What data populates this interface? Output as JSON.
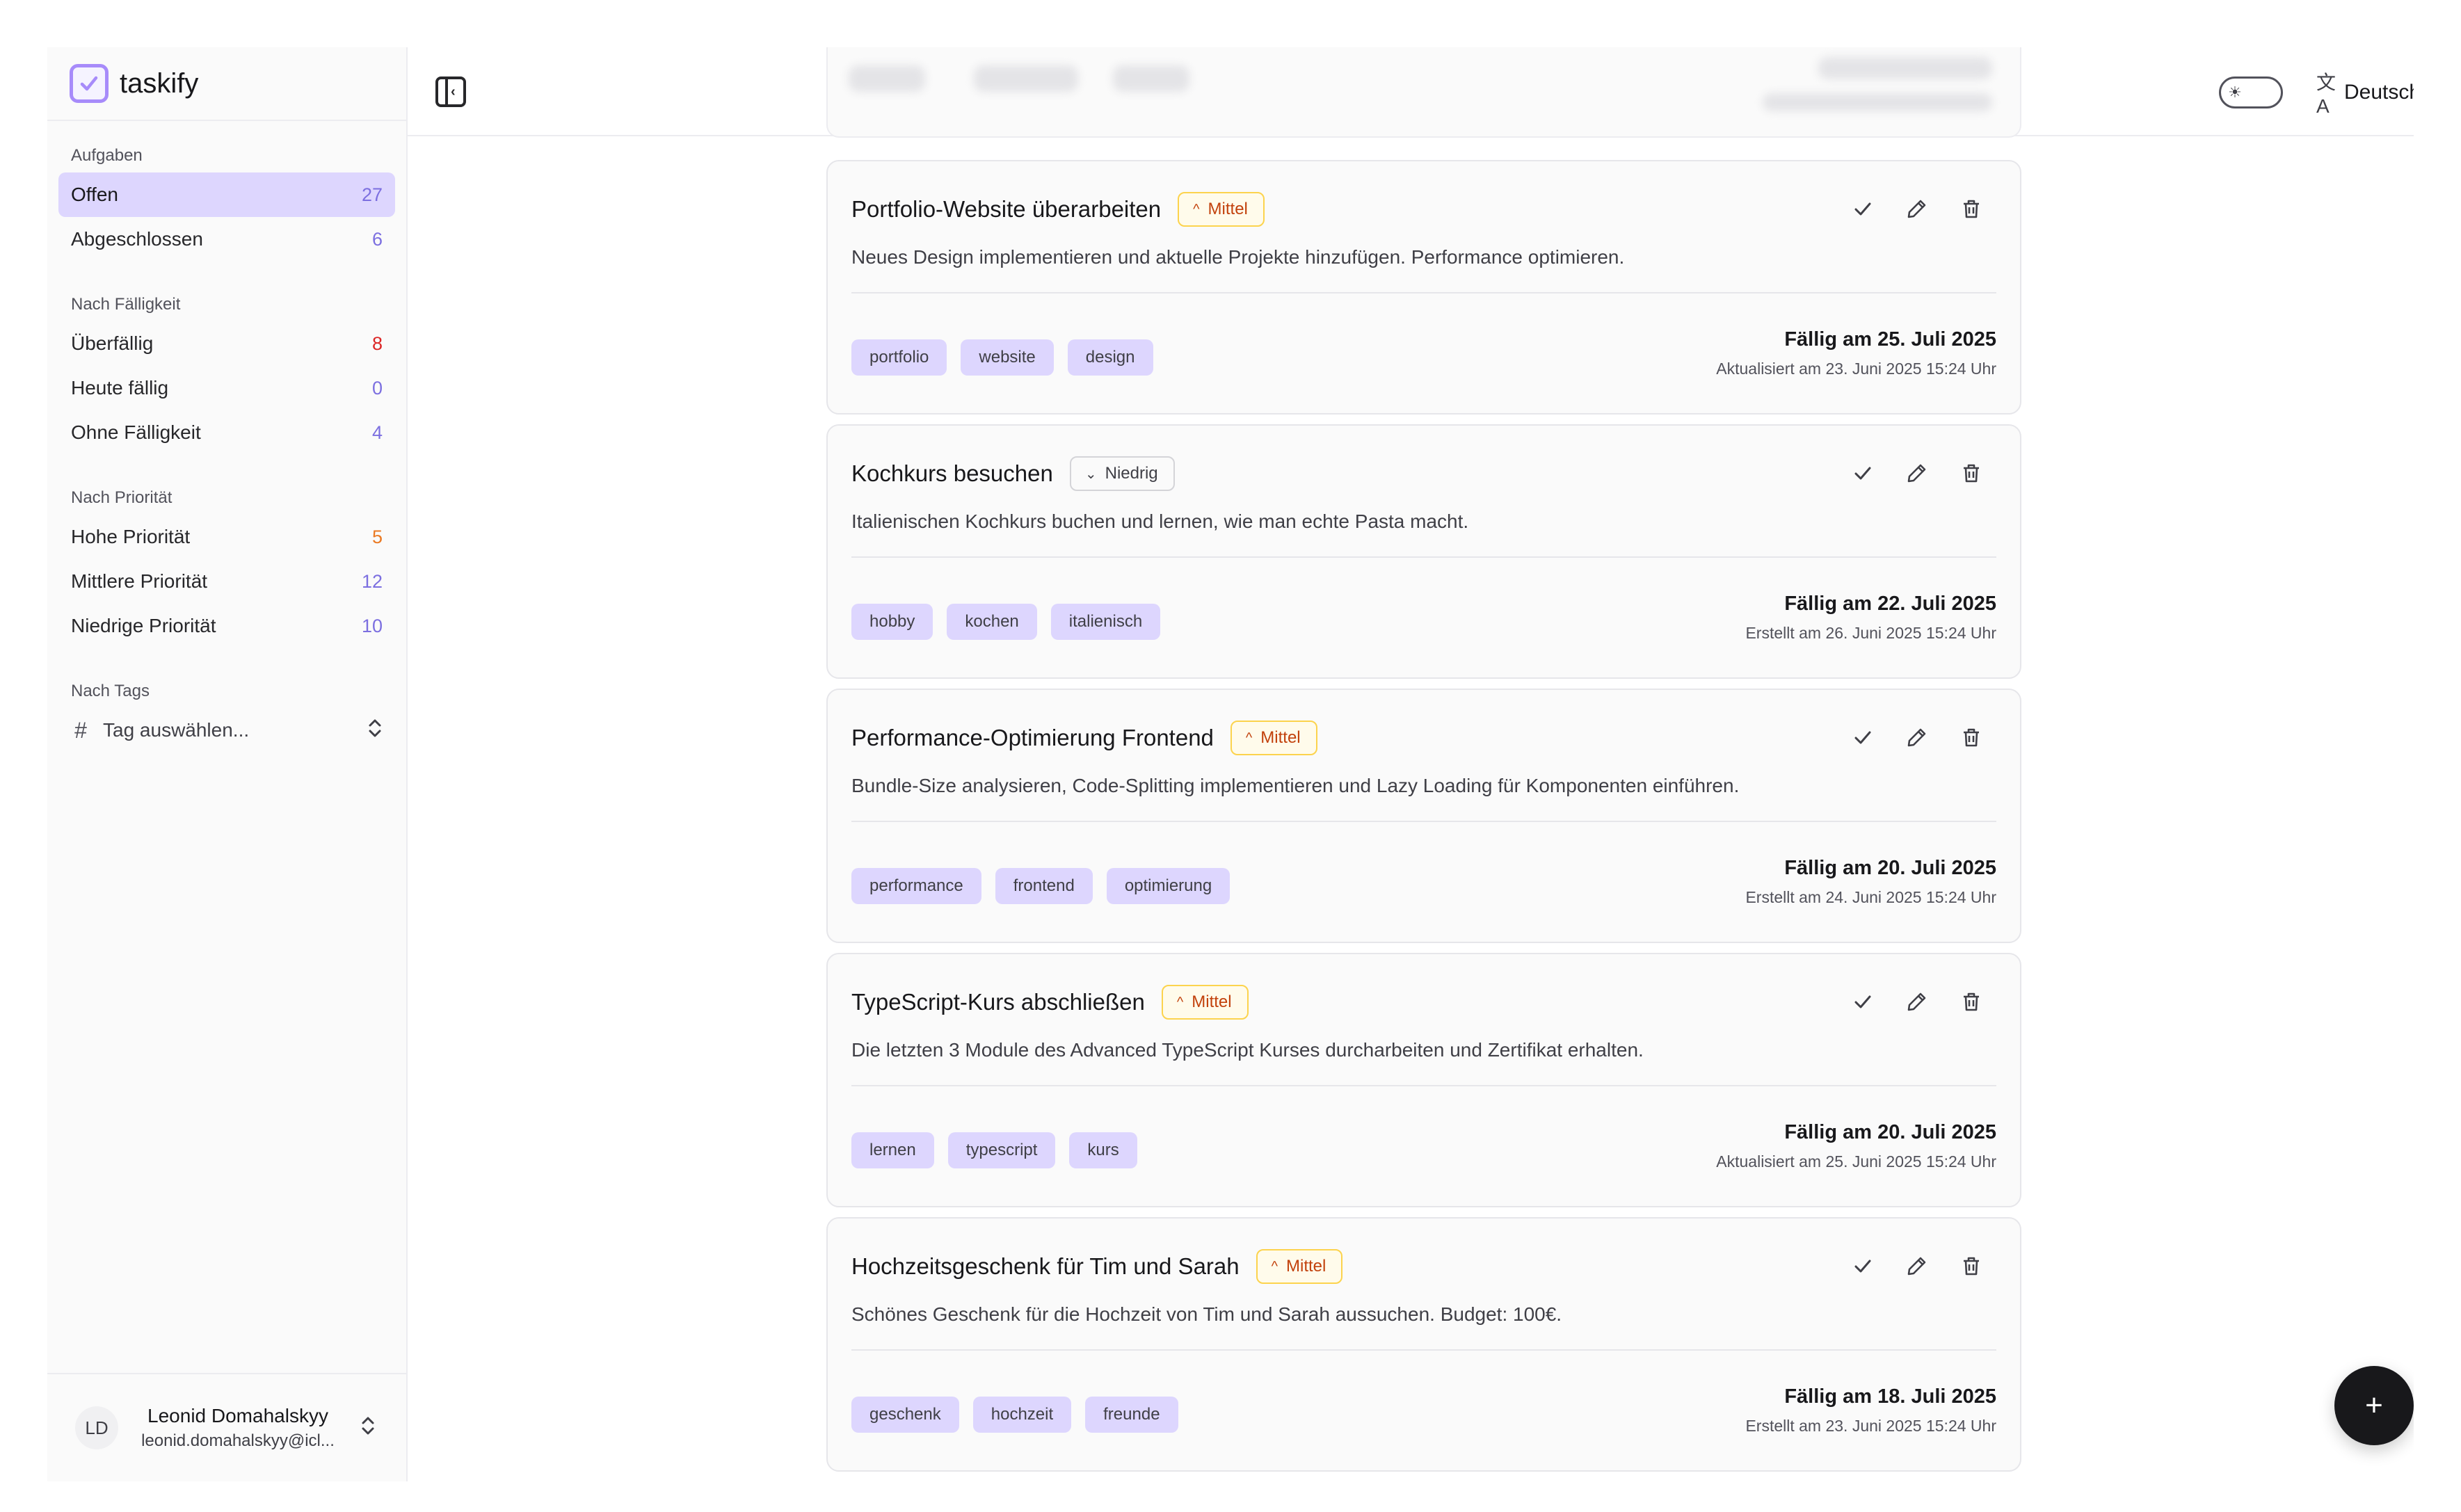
{
  "app": {
    "name": "taskify"
  },
  "sidebar": {
    "sections": {
      "tasks": "Aufgaben",
      "due": "Nach Fälligkeit",
      "priority": "Nach Priorität",
      "tags": "Nach Tags"
    },
    "tasks": [
      {
        "label": "Offen",
        "count": "27"
      },
      {
        "label": "Abgeschlossen",
        "count": "6"
      }
    ],
    "due": [
      {
        "label": "Überfällig",
        "count": "8"
      },
      {
        "label": "Heute fällig",
        "count": "0"
      },
      {
        "label": "Ohne Fälligkeit",
        "count": "4"
      }
    ],
    "priority": [
      {
        "label": "Hohe Priorität",
        "count": "5"
      },
      {
        "label": "Mittlere Priorität",
        "count": "12"
      },
      {
        "label": "Niedrige Priorität",
        "count": "10"
      }
    ],
    "tag_select": {
      "placeholder": "Tag auswählen..."
    },
    "user": {
      "initials": "LD",
      "name": "Leonid Domahalskyy",
      "email": "leonid.domahalskyy@icl..."
    }
  },
  "header": {
    "language": "Deutsch"
  },
  "colors": {
    "accent": "#ddd6fe",
    "accent_text": "#7c6fe0",
    "overdue": "#dc2626",
    "high": "#ea7a24",
    "medium_badge": "#c2410c"
  },
  "tasks": [
    {
      "title": "Portfolio-Website überarbeiten",
      "priority": "Mittel",
      "description": "Neues Design implementieren und aktuelle Projekte hinzufügen. Performance optimieren.",
      "tags": [
        "portfolio",
        "website",
        "design"
      ],
      "due": "Fällig am 25. Juli 2025",
      "meta": "Aktualisiert am 23. Juni 2025 15:24 Uhr"
    },
    {
      "title": "Kochkurs besuchen",
      "priority": "Niedrig",
      "description": "Italienischen Kochkurs buchen und lernen, wie man echte Pasta macht.",
      "tags": [
        "hobby",
        "kochen",
        "italienisch"
      ],
      "due": "Fällig am 22. Juli 2025",
      "meta": "Erstellt am 26. Juni 2025 15:24 Uhr"
    },
    {
      "title": "Performance-Optimierung Frontend",
      "priority": "Mittel",
      "description": "Bundle-Size analysieren, Code-Splitting implementieren und Lazy Loading für Komponenten einführen.",
      "tags": [
        "performance",
        "frontend",
        "optimierung"
      ],
      "due": "Fällig am 20. Juli 2025",
      "meta": "Erstellt am 24. Juni 2025 15:24 Uhr"
    },
    {
      "title": "TypeScript-Kurs abschließen",
      "priority": "Mittel",
      "description": "Die letzten 3 Module des Advanced TypeScript Kurses durcharbeiten und Zertifikat erhalten.",
      "tags": [
        "lernen",
        "typescript",
        "kurs"
      ],
      "due": "Fällig am 20. Juli 2025",
      "meta": "Aktualisiert am 25. Juni 2025 15:24 Uhr"
    },
    {
      "title": "Hochzeitsgeschenk für Tim und Sarah",
      "priority": "Mittel",
      "description": "Schönes Geschenk für die Hochzeit von Tim und Sarah aussuchen. Budget: 100€.",
      "tags": [
        "geschenk",
        "hochzeit",
        "freunde"
      ],
      "due": "Fällig am 18. Juli 2025",
      "meta": "Erstellt am 23. Juni 2025 15:24 Uhr"
    }
  ]
}
